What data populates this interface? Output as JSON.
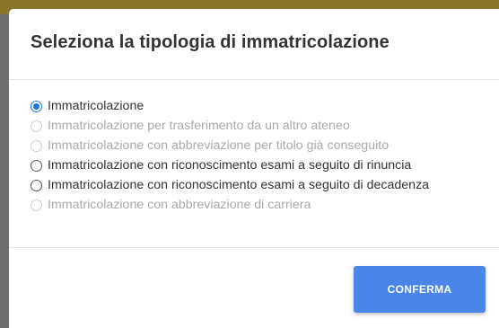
{
  "modal": {
    "title": "Seleziona la tipologia di immatricolazione",
    "options": [
      {
        "label": "Immatricolazione",
        "checked": true,
        "disabled": false
      },
      {
        "label": "Immatricolazione per trasferimento da un altro ateneo",
        "checked": false,
        "disabled": true
      },
      {
        "label": "Immatricolazione con abbreviazione per titolo già conseguito",
        "checked": false,
        "disabled": true
      },
      {
        "label": "Immatricolazione con riconoscimento esami a seguito di rinuncia",
        "checked": false,
        "disabled": false
      },
      {
        "label": "Immatricolazione con riconoscimento esami a seguito di decadenza",
        "checked": false,
        "disabled": false
      },
      {
        "label": "Immatricolazione con abbreviazione di carriera",
        "checked": false,
        "disabled": true
      }
    ],
    "confirm_label": "CONFERMA"
  },
  "colors": {
    "accent": "#4a86e8",
    "overlay": "#6b6b6b",
    "top_bar": "#8a7628"
  }
}
